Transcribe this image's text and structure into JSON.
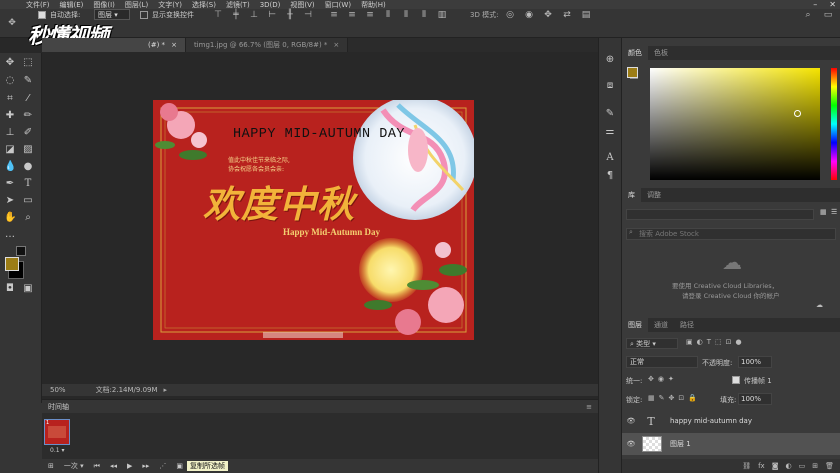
{
  "menu": [
    "文件(F)",
    "编辑(E)",
    "图像(I)",
    "图层(L)",
    "文字(Y)",
    "选择(S)",
    "滤镜(T)",
    "3D(D)",
    "视图(V)",
    "窗口(W)",
    "帮助(H)"
  ],
  "options": {
    "auto_select_label": "自动选择:",
    "layer_select": "图层",
    "show_transform_label": "显示变换控件",
    "mode_3d": "3D 模式:"
  },
  "watermark": "秒懂视频",
  "tabs": [
    {
      "label": "(#) *",
      "close": "×"
    },
    {
      "label": "timg1.jpg @ 66.7% (图层 0, RGB/8#) *",
      "close": "×"
    }
  ],
  "artwork": {
    "heading": "HAPPY MID-AUTUMN DAY",
    "subline1": "值此中秋佳节来临之际,",
    "subline2": "协会祝愿各会员会亲:",
    "title_cn": "欢度中秋",
    "title_en": "Happy Mid-Autumn Day"
  },
  "status": {
    "zoom": "50%",
    "doc": "文档:2.14M/9.09M"
  },
  "timeline": {
    "label": "时间轴",
    "frame_time": "0.1",
    "loop": "一次",
    "tooltip": "复制所选帧"
  },
  "panels": {
    "color_tabs": [
      "颜色",
      "色板"
    ],
    "library_tabs": [
      "库",
      "调整"
    ],
    "library_search_placeholder": "搜索 Adobe Stock",
    "cc_line1": "要使用 Creative Cloud Libraries，",
    "cc_line2": "请登录 Creative Cloud 你的帐户",
    "layers_tabs": [
      "图层",
      "通道",
      "路径"
    ],
    "kind_select": "类型",
    "blend_mode": "正常",
    "opacity_label": "不透明度:",
    "opacity_value": "100%",
    "unify_label": "统一:",
    "propagate_label": "传播帧 1",
    "lock_label": "锁定:",
    "fill_label": "填充:",
    "fill_value": "100%",
    "layers": [
      {
        "name": "happy mid-autumn day",
        "type": "text"
      },
      {
        "name": "图层 1",
        "type": "pixel"
      }
    ]
  },
  "colors": {
    "foreground": "#9c7d16",
    "background": "#000000",
    "canvas_red": "#b8221e",
    "accent_gold": "#f0b83a"
  }
}
